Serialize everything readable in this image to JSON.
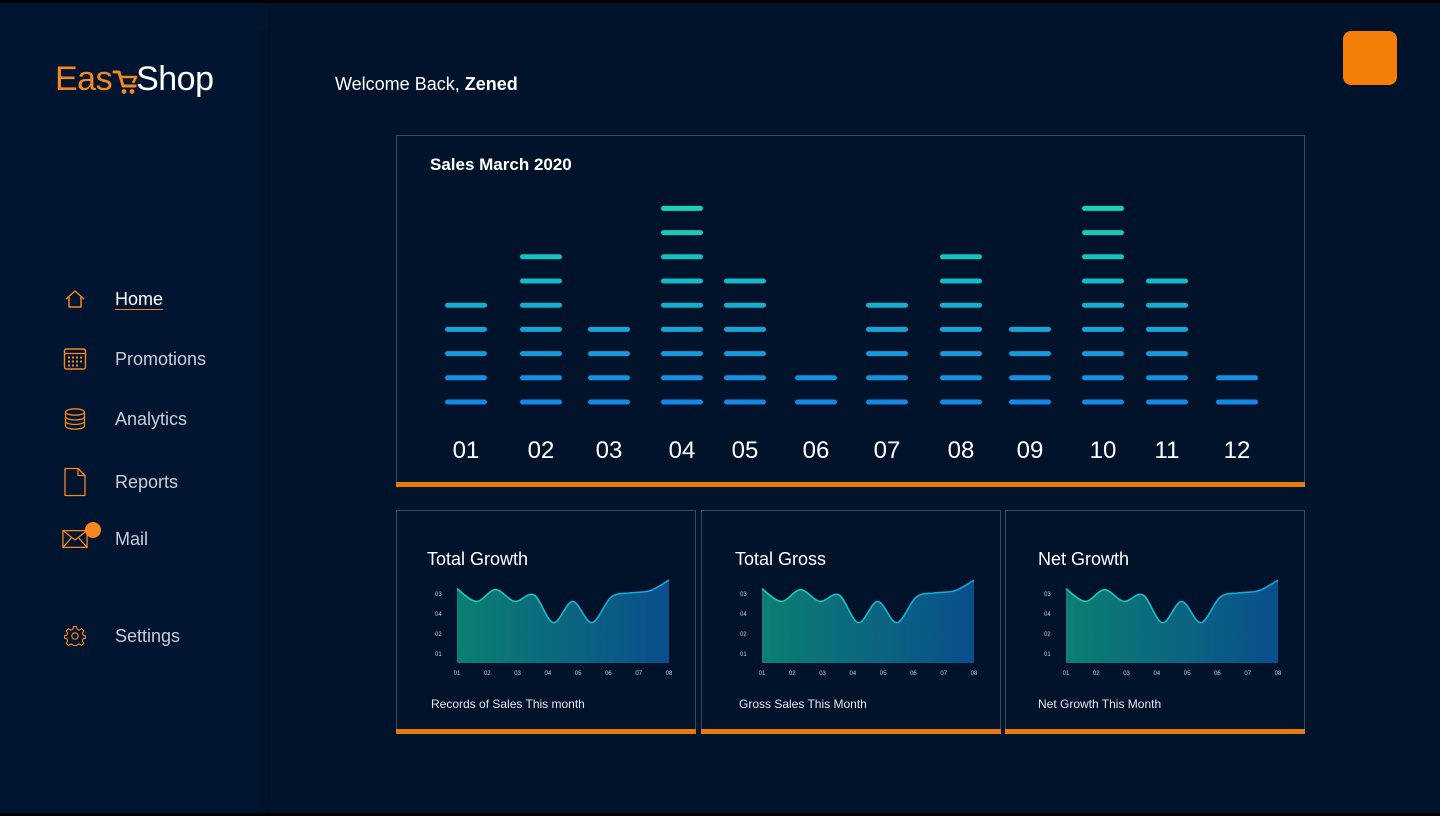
{
  "brand": {
    "name_part1": "Eas",
    "name_part2": "Shop"
  },
  "sidebar": {
    "items": [
      {
        "label": "Home",
        "icon": "home-icon"
      },
      {
        "label": "Promotions",
        "icon": "calendar-icon"
      },
      {
        "label": "Analytics",
        "icon": "database-icon"
      },
      {
        "label": "Reports",
        "icon": "document-icon"
      },
      {
        "label": "Mail",
        "icon": "mail-icon"
      },
      {
        "label": "Settings",
        "icon": "gear-icon"
      }
    ]
  },
  "header": {
    "welcome_prefix": "Welcome Back, ",
    "user_name": "Zened"
  },
  "colors": {
    "accent": "#f6861f",
    "background": "#01132b",
    "teal": "#16d1b0",
    "blue": "#1a8fe6"
  },
  "sales_chart": {
    "title": "Sales March 2020",
    "chart_data": {
      "type": "bar",
      "title": "Sales March 2020",
      "categories": [
        "01",
        "02",
        "03",
        "04",
        "05",
        "06",
        "07",
        "08",
        "09",
        "10",
        "11",
        "12"
      ],
      "values": [
        5,
        7,
        4,
        9,
        6,
        2,
        5,
        7,
        4,
        9,
        6,
        2
      ]
    }
  },
  "stat_cards": [
    {
      "title": "Total Growth",
      "caption": "Records of Sales This month",
      "chart_data": {
        "type": "area",
        "x": [
          "01",
          "02",
          "03",
          "04",
          "05",
          "06",
          "07",
          "08"
        ],
        "y_ticks": [
          "01",
          "02",
          "04",
          "03"
        ],
        "values": [
          3.5,
          2.9,
          3.45,
          2.9,
          3.2,
          1.9,
          2.9,
          1.9,
          3.1,
          3.3,
          3.4,
          3.9
        ]
      }
    },
    {
      "title": "Total Gross",
      "caption": "Gross Sales This Month",
      "chart_data": {
        "type": "area",
        "x": [
          "01",
          "02",
          "03",
          "04",
          "05",
          "06",
          "07",
          "08"
        ],
        "y_ticks": [
          "01",
          "02",
          "04",
          "03"
        ],
        "values": [
          3.5,
          2.9,
          3.45,
          2.9,
          3.2,
          1.9,
          2.9,
          1.9,
          3.1,
          3.3,
          3.4,
          3.9
        ]
      }
    },
    {
      "title": "Net Growth",
      "caption": "Net Growth This Month",
      "chart_data": {
        "type": "area",
        "x": [
          "01",
          "02",
          "03",
          "04",
          "05",
          "06",
          "07",
          "08"
        ],
        "y_ticks": [
          "01",
          "02",
          "04",
          "03"
        ],
        "values": [
          3.5,
          2.9,
          3.45,
          2.9,
          3.2,
          1.9,
          2.9,
          1.9,
          3.1,
          3.3,
          3.4,
          3.9
        ]
      }
    }
  ]
}
